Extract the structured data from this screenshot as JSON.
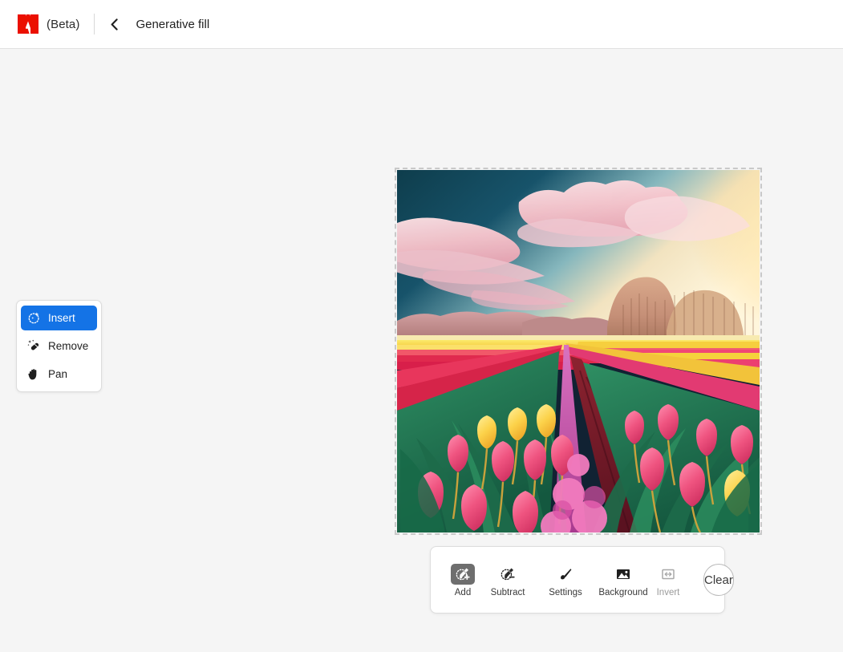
{
  "header": {
    "logo_icon": "adobe-logo-icon",
    "beta_label": "(Beta)",
    "back_icon": "chevron-left-icon",
    "title": "Generative fill"
  },
  "tool_panel": {
    "items": [
      {
        "label": "Insert",
        "icon": "sparkle-circle-icon",
        "selected": true
      },
      {
        "label": "Remove",
        "icon": "magic-wand-icon",
        "selected": false
      },
      {
        "label": "Pan",
        "icon": "hand-icon",
        "selected": false
      }
    ]
  },
  "toolbar": {
    "items": [
      {
        "label": "Add",
        "icon": "brush-plus-icon",
        "active": true
      },
      {
        "label": "Subtract",
        "icon": "brush-minus-icon",
        "active": false
      },
      {
        "label": "Settings",
        "icon": "paintbrush-icon",
        "active": false
      },
      {
        "label": "Background",
        "icon": "image-icon",
        "active": false
      },
      {
        "label": "Invert",
        "icon": "invert-arrows-icon",
        "active": false
      }
    ],
    "clear_label": "Clear"
  },
  "image": {
    "alt_name": "tulip-field-landscape",
    "description": "Field of pink and yellow tulips under a teal sky with pink clouds and a golden sunset"
  },
  "colors": {
    "accent_blue": "#1473e6",
    "adobe_red": "#eb1000",
    "page_background": "#f5f5f5",
    "header_background": "#ffffff",
    "active_tool_gray": "#6e6e6e"
  }
}
